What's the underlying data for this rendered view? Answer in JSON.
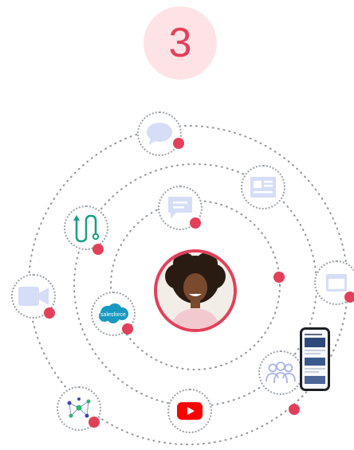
{
  "step": {
    "number": "3"
  },
  "nodes": [
    {
      "name": "chat-bubble-icon"
    },
    {
      "name": "newsletter-icon"
    },
    {
      "name": "message-icon"
    },
    {
      "name": "journey-path-icon"
    },
    {
      "name": "video-camera-icon"
    },
    {
      "name": "salesforce-logo-icon",
      "logo_text": "salesforce"
    },
    {
      "name": "browser-window-icon"
    },
    {
      "name": "network-graph-icon"
    },
    {
      "name": "youtube-logo-icon"
    },
    {
      "name": "community-icon"
    }
  ],
  "colors": {
    "accent": "#e2405a",
    "badge_bg": "#fde3e6",
    "icon_light": "#d6ddf7",
    "teal": "#1a9e85",
    "salesforce": "#1798c1",
    "youtube": "#ff0000"
  }
}
